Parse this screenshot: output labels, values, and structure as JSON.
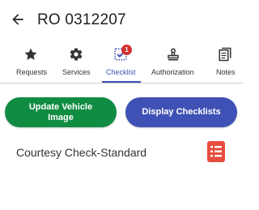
{
  "header": {
    "title": "RO 0312207"
  },
  "tabs": [
    {
      "label": "Requests",
      "icon": "star-icon"
    },
    {
      "label": "Services",
      "icon": "gear-icon"
    },
    {
      "label": "Checklist",
      "icon": "checklist-icon",
      "badge": "1",
      "active": true
    },
    {
      "label": "Authorization",
      "icon": "stamp-icon"
    },
    {
      "label": "Notes",
      "icon": "notes-icon"
    }
  ],
  "buttons": {
    "update_vehicle_image": "Update Vehicle Image",
    "display_checklists": "Display Checklists"
  },
  "checklist": {
    "items": [
      {
        "name": "Courtesy Check-Standard",
        "icon": "document-icon"
      }
    ]
  },
  "colors": {
    "accent": "#3f51b5",
    "green_button": "#118c43",
    "badge": "#d32f2f",
    "document_icon": "#e74c3c"
  }
}
